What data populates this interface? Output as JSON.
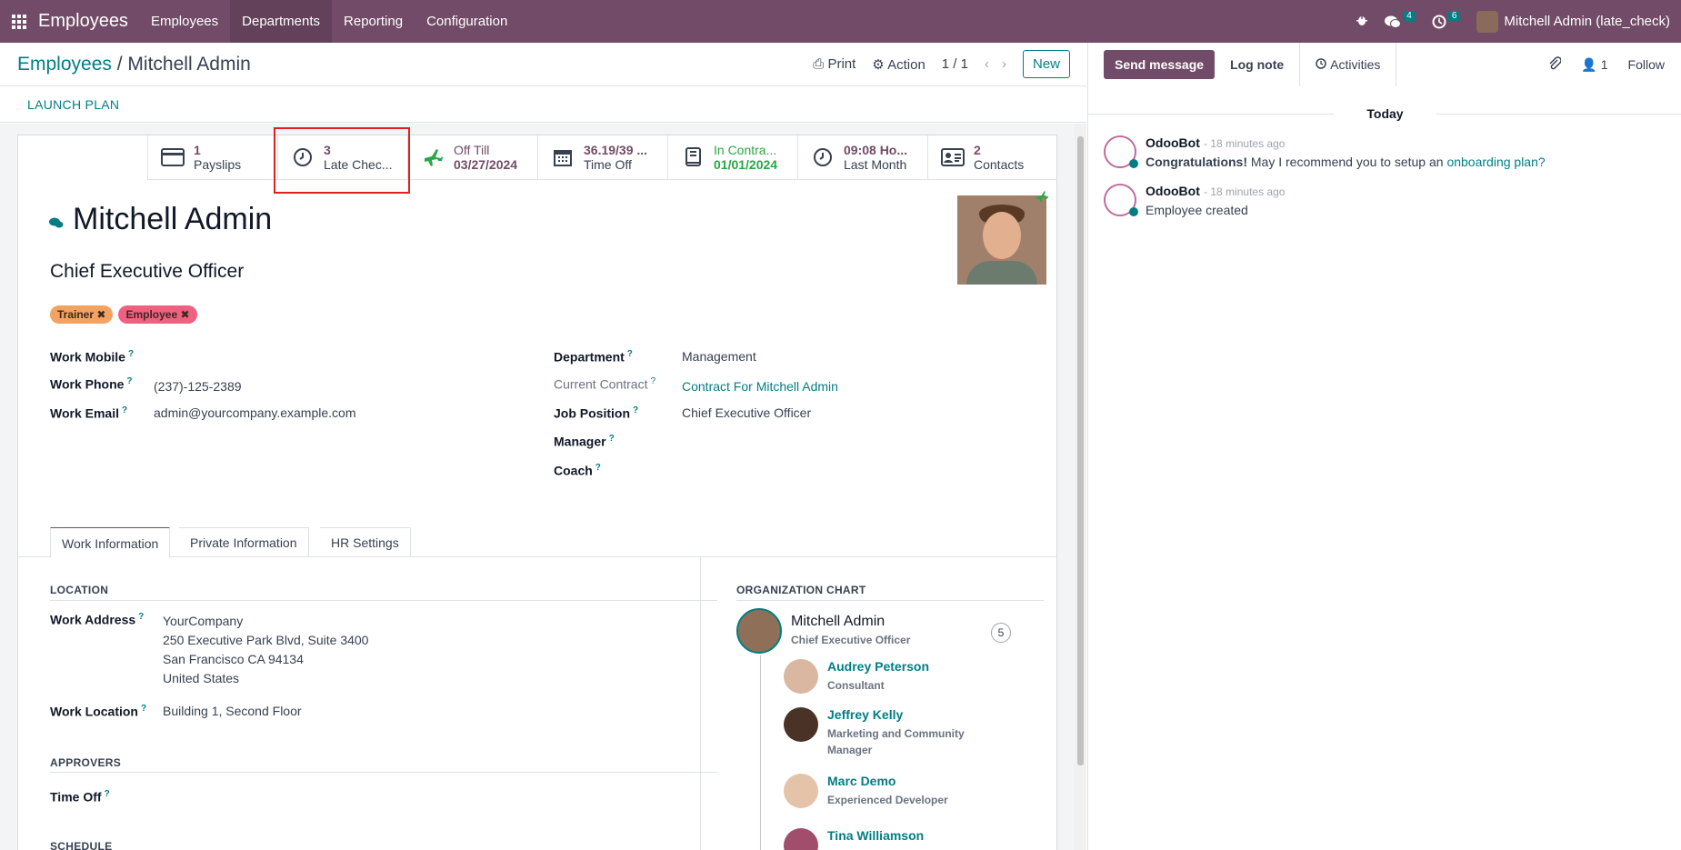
{
  "topbar": {
    "brand": "Employees",
    "menu": [
      "Employees",
      "Departments",
      "Reporting",
      "Configuration"
    ],
    "messages_count": "4",
    "activities_count": "6",
    "user": "Mitchell Admin (late_check)"
  },
  "control": {
    "breadcrumb_root": "Employees",
    "breadcrumb_sep": "/",
    "breadcrumb_current": "Mitchell Admin",
    "print": "Print",
    "action": "Action",
    "pager": "1 / 1",
    "new": "New",
    "launch_plan": "LAUNCH PLAN"
  },
  "stats": [
    {
      "value": "1",
      "label": "Payslips"
    },
    {
      "value": "3",
      "label": "Late Chec..."
    },
    {
      "value": "Off Till",
      "label": "03/27/2024"
    },
    {
      "value": "36.19/39 ...",
      "label": "Time Off"
    },
    {
      "value": "In Contra...",
      "label": "01/01/2024"
    },
    {
      "value": "09:08 Ho...",
      "label": "Last Month"
    },
    {
      "value": "2",
      "label": "Contacts"
    }
  ],
  "employee": {
    "name": "Mitchell Admin",
    "job_title": "Chief Executive Officer",
    "tags": [
      "Trainer",
      "Employee"
    ]
  },
  "fields_left": {
    "work_mobile_label": "Work Mobile",
    "work_mobile": "",
    "work_phone_label": "Work Phone",
    "work_phone": "(237)-125-2389",
    "work_email_label": "Work Email",
    "work_email": "admin@yourcompany.example.com"
  },
  "fields_right": {
    "department_label": "Department",
    "department": "Management",
    "contract_label": "Current Contract",
    "contract": "Contract For Mitchell Admin",
    "job_position_label": "Job Position",
    "job_position": "Chief Executive Officer",
    "manager_label": "Manager",
    "coach_label": "Coach"
  },
  "tabs": [
    "Work Information",
    "Private Information",
    "HR Settings"
  ],
  "location": {
    "title": "LOCATION",
    "work_address_label": "Work Address",
    "address_lines": [
      "YourCompany",
      "250 Executive Park Blvd, Suite 3400",
      "San Francisco CA 94134",
      "United States"
    ],
    "work_location_label": "Work Location",
    "work_location": "Building 1, Second Floor"
  },
  "approvers": {
    "title": "APPROVERS",
    "time_off_label": "Time Off"
  },
  "schedule": {
    "title": "SCHEDULE"
  },
  "org_chart": {
    "title": "ORGANIZATION CHART",
    "self_name": "Mitchell Admin",
    "self_job": "Chief Executive Officer",
    "self_count": "5",
    "subordinates": [
      {
        "name": "Audrey Peterson",
        "job": "Consultant"
      },
      {
        "name": "Jeffrey Kelly",
        "job": "Marketing and Community Manager"
      },
      {
        "name": "Marc Demo",
        "job": "Experienced Developer"
      },
      {
        "name": "Tina Williamson",
        "job": ""
      }
    ]
  },
  "chatter": {
    "send_message": "Send message",
    "log_note": "Log note",
    "activities": "Activities",
    "followers_count": "1",
    "follow": "Follow",
    "today": "Today",
    "messages": [
      {
        "author": "OdooBot",
        "time": "- 18 minutes ago",
        "bold": "Congratulations!",
        "text": " May I recommend you to setup an ",
        "link": "onboarding plan?"
      },
      {
        "author": "OdooBot",
        "time": "- 18 minutes ago",
        "text": "Employee created"
      }
    ]
  },
  "colors": {
    "brand": "#714B67",
    "accent": "#017e84",
    "highlight": "#e02020"
  }
}
